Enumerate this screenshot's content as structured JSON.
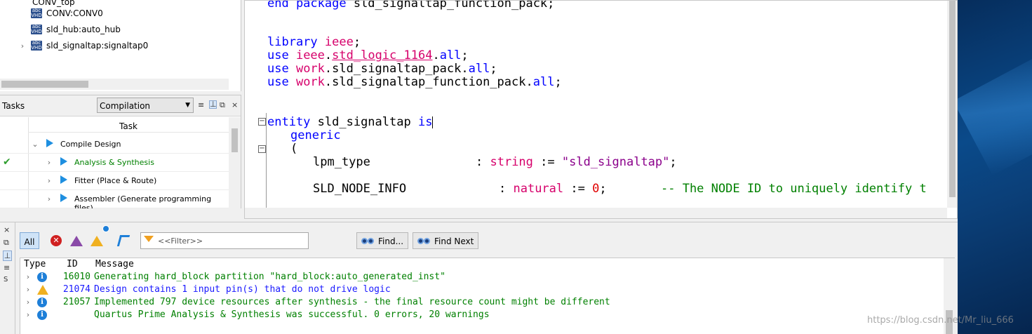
{
  "hierarchy": {
    "top_item": "CONV_top",
    "items": [
      {
        "label": "CONV:CONV0",
        "icon": "vhdl-file-icon",
        "expandable": false
      },
      {
        "label": "sld_hub:auto_hub",
        "icon": "vhdl-file-icon",
        "expandable": false
      },
      {
        "label": "sld_signaltap:signaltap0",
        "icon": "vhdl-file-icon",
        "expandable": true
      }
    ]
  },
  "tasks": {
    "title": "Tasks",
    "flow": "Compilation",
    "column": "Task",
    "rows": [
      {
        "label": "Compile Design",
        "status": "",
        "level": 0
      },
      {
        "label": "Analysis & Synthesis",
        "status": "✔",
        "level": 1
      },
      {
        "label": "Fitter (Place & Route)",
        "status": "",
        "level": 1
      },
      {
        "label": "Assembler (Generate programming files)",
        "status": "",
        "level": 1
      }
    ]
  },
  "editor": {
    "lines": {
      "end_pkg": [
        "end package ",
        "sld_signaltap_function_pack;"
      ],
      "library": [
        "library ",
        "ieee",
        ";"
      ],
      "use1": [
        "use ",
        "ieee",
        ".",
        "std_logic_1164",
        ".",
        "all",
        ";"
      ],
      "use2": [
        "use ",
        "work",
        ".sld_signaltap_pack.",
        "all",
        ";"
      ],
      "use3": [
        "use ",
        "work",
        ".sld_signaltap_function_pack.",
        "all",
        ";"
      ],
      "entity": [
        "entity",
        " sld_signaltap ",
        "is"
      ],
      "generic": "generic",
      "paren": "(",
      "lpm_name": "lpm_type",
      "lpm_sep": ": ",
      "lpm_type": "string",
      "lpm_assign": " := ",
      "lpm_value": "\"sld_signaltap\"",
      "lpm_end": ";",
      "node_name": "SLD_NODE_INFO",
      "node_sep": ": ",
      "node_type": "natural",
      "node_assign": " := ",
      "node_value": "0",
      "node_end": ";",
      "node_comment": "-- The NODE ID to uniquely identify t"
    }
  },
  "messages": {
    "filter_all": "All",
    "filter_placeholder": "<<Filter>>",
    "find_label": "Find...",
    "find_next_label": "Find Next",
    "columns": {
      "type": "Type",
      "id": "ID",
      "message": "Message"
    },
    "side_label": "S",
    "rows": [
      {
        "type": "info",
        "id": "16010",
        "text": "Generating hard_block partition \"hard_block:auto_generated_inst\"",
        "color": "#008000"
      },
      {
        "type": "warning",
        "id": "21074",
        "text": "Design contains 1 input pin(s) that do not drive logic",
        "color": "#1a1aff"
      },
      {
        "type": "info",
        "id": "21057",
        "text": "Implemented 797 device resources after synthesis - the final resource count might be different",
        "color": "#008000"
      },
      {
        "type": "info",
        "id": "",
        "text": "Quartus Prime Analysis & Synthesis was successful. 0 errors, 20 warnings",
        "color": "#008000"
      }
    ]
  },
  "watermark": "https://blog.csdn.net/Mr_liu_666"
}
